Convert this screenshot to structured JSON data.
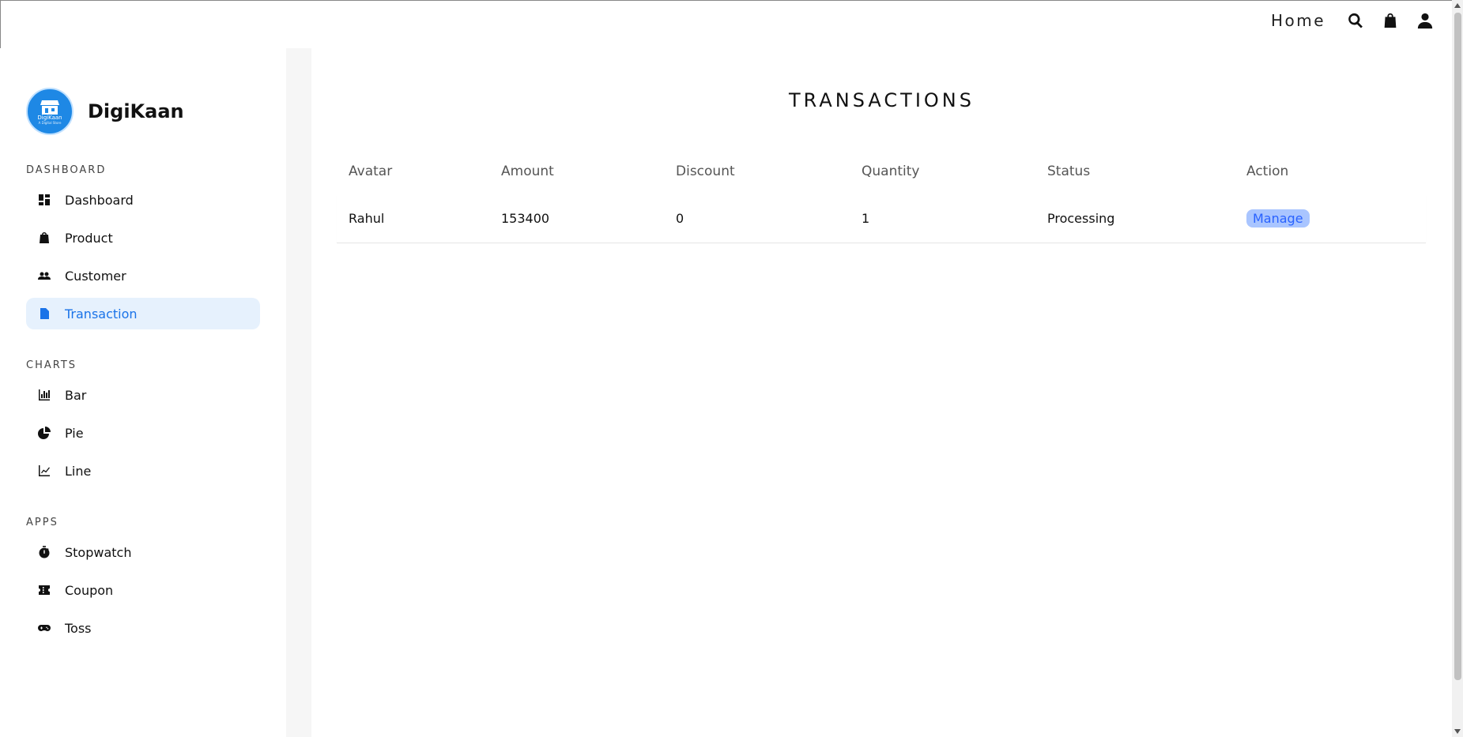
{
  "topnav": {
    "home_label": "Home",
    "icons": [
      "search-icon",
      "shopping-bag-icon",
      "user-icon"
    ]
  },
  "brand": {
    "name": "DigiKaan",
    "logo_title": "DigiKaan",
    "logo_subtitle": "A Digital Store",
    "color": "#1e88e5"
  },
  "sidebar": {
    "sections": [
      {
        "title": "DASHBOARD",
        "items": [
          {
            "label": "Dashboard",
            "icon": "dashboard-icon"
          },
          {
            "label": "Product",
            "icon": "shopping-bag-icon"
          },
          {
            "label": "Customer",
            "icon": "people-icon"
          },
          {
            "label": "Transaction",
            "icon": "receipt-icon",
            "active": true
          }
        ]
      },
      {
        "title": "CHARTS",
        "items": [
          {
            "label": "Bar",
            "icon": "bar-chart-icon"
          },
          {
            "label": "Pie",
            "icon": "pie-chart-icon"
          },
          {
            "label": "Line",
            "icon": "line-chart-icon"
          }
        ]
      },
      {
        "title": "APPS",
        "items": [
          {
            "label": "Stopwatch",
            "icon": "stopwatch-icon"
          },
          {
            "label": "Coupon",
            "icon": "coupon-icon"
          },
          {
            "label": "Toss",
            "icon": "gamepad-icon"
          }
        ]
      }
    ],
    "active_color": "#1a73e8"
  },
  "main": {
    "title": "TRANSACTIONS",
    "table": {
      "headers": [
        "Avatar",
        "Amount",
        "Discount",
        "Quantity",
        "Status",
        "Action"
      ],
      "rows": [
        {
          "avatar": "Rahul",
          "amount": "153400",
          "discount": "0",
          "quantity": "1",
          "status": "Processing",
          "action": "Manage"
        }
      ]
    },
    "status_color": "#e4141b"
  }
}
